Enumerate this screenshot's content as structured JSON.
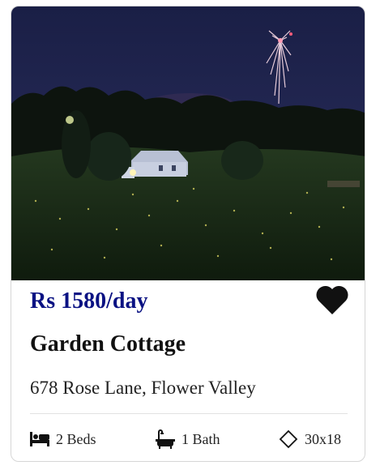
{
  "listing": {
    "price": "Rs 1580/day",
    "title": "Garden Cottage",
    "address": "678 Rose Lane, Flower Valley",
    "favorite": true,
    "features": {
      "beds": "2 Beds",
      "bath": "1 Bath",
      "size": "30x18"
    }
  },
  "icons": {
    "favorite": "heart-icon",
    "beds": "bed-icon",
    "bath": "bathtub-icon",
    "size": "diamond-area-icon"
  },
  "colors": {
    "price": "#0a1283",
    "text": "#111111",
    "border": "#d6d6d6"
  }
}
